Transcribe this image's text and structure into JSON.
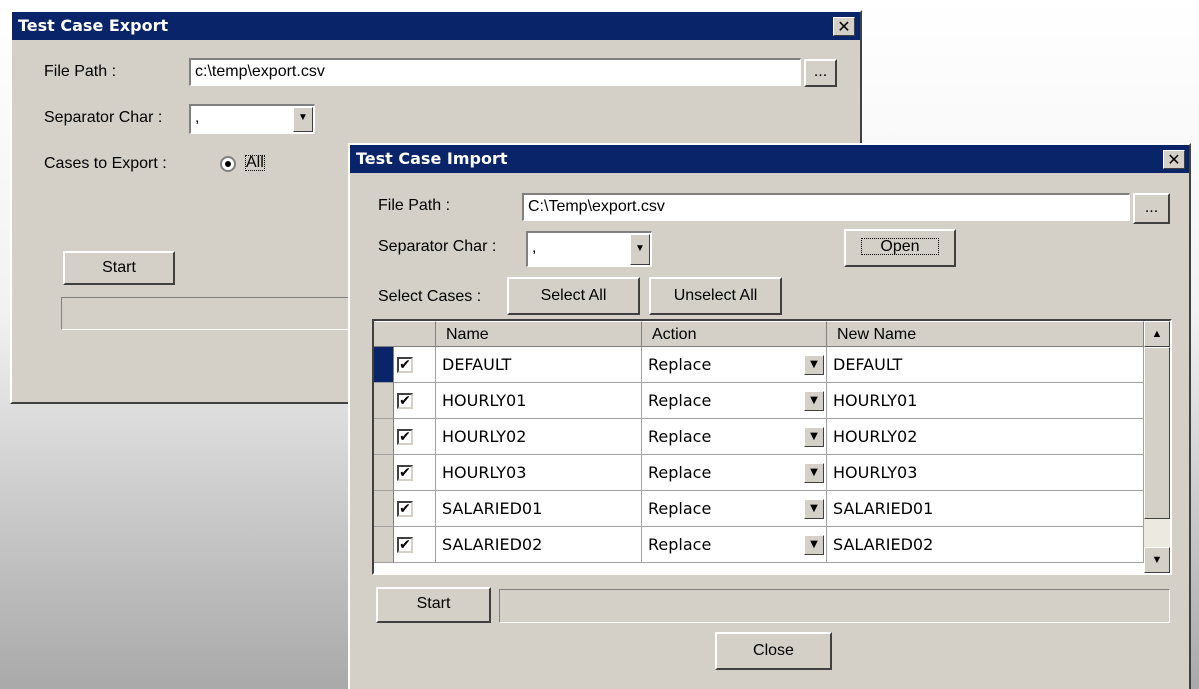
{
  "export_dialog": {
    "title": "Test Case Export",
    "close_glyph": "✕",
    "file_path_label": "File Path :",
    "file_path_value": "c:\\temp\\export.csv",
    "browse_label": "...",
    "separator_label": "Separator Char :",
    "separator_value": ",",
    "cases_label": "Cases to Export :",
    "radio_all_label": "All",
    "start_label": "Start"
  },
  "import_dialog": {
    "title": "Test Case Import",
    "close_glyph": "✕",
    "file_path_label": "File Path :",
    "file_path_value": "C:\\Temp\\export.csv",
    "browse_label": "...",
    "separator_label": "Separator Char :",
    "separator_value": ",",
    "open_label": "Open",
    "select_cases_label": "Select Cases :",
    "select_all_label": "Select All",
    "unselect_all_label": "Unselect All",
    "grid": {
      "columns": [
        "Name",
        "Action",
        "New Name"
      ],
      "rows": [
        {
          "checked": "✔",
          "name": "DEFAULT",
          "action": "Replace",
          "new_name": "DEFAULT"
        },
        {
          "checked": "✔",
          "name": "HOURLY01",
          "action": "Replace",
          "new_name": "HOURLY01"
        },
        {
          "checked": "✔",
          "name": "HOURLY02",
          "action": "Replace",
          "new_name": "HOURLY02"
        },
        {
          "checked": "✔",
          "name": "HOURLY03",
          "action": "Replace",
          "new_name": "HOURLY03"
        },
        {
          "checked": "✔",
          "name": "SALARIED01",
          "action": "Replace",
          "new_name": "SALARIED01"
        },
        {
          "checked": "✔",
          "name": "SALARIED02",
          "action": "Replace",
          "new_name": "SALARIED02"
        }
      ]
    },
    "start_label": "Start",
    "close_label": "Close"
  },
  "icons": {
    "dropdown_arrow": "▼",
    "scroll_up": "▲",
    "scroll_down": "▼"
  },
  "colors": {
    "titlebar": "#0a246a",
    "dialog_face": "#d4d0c8"
  }
}
